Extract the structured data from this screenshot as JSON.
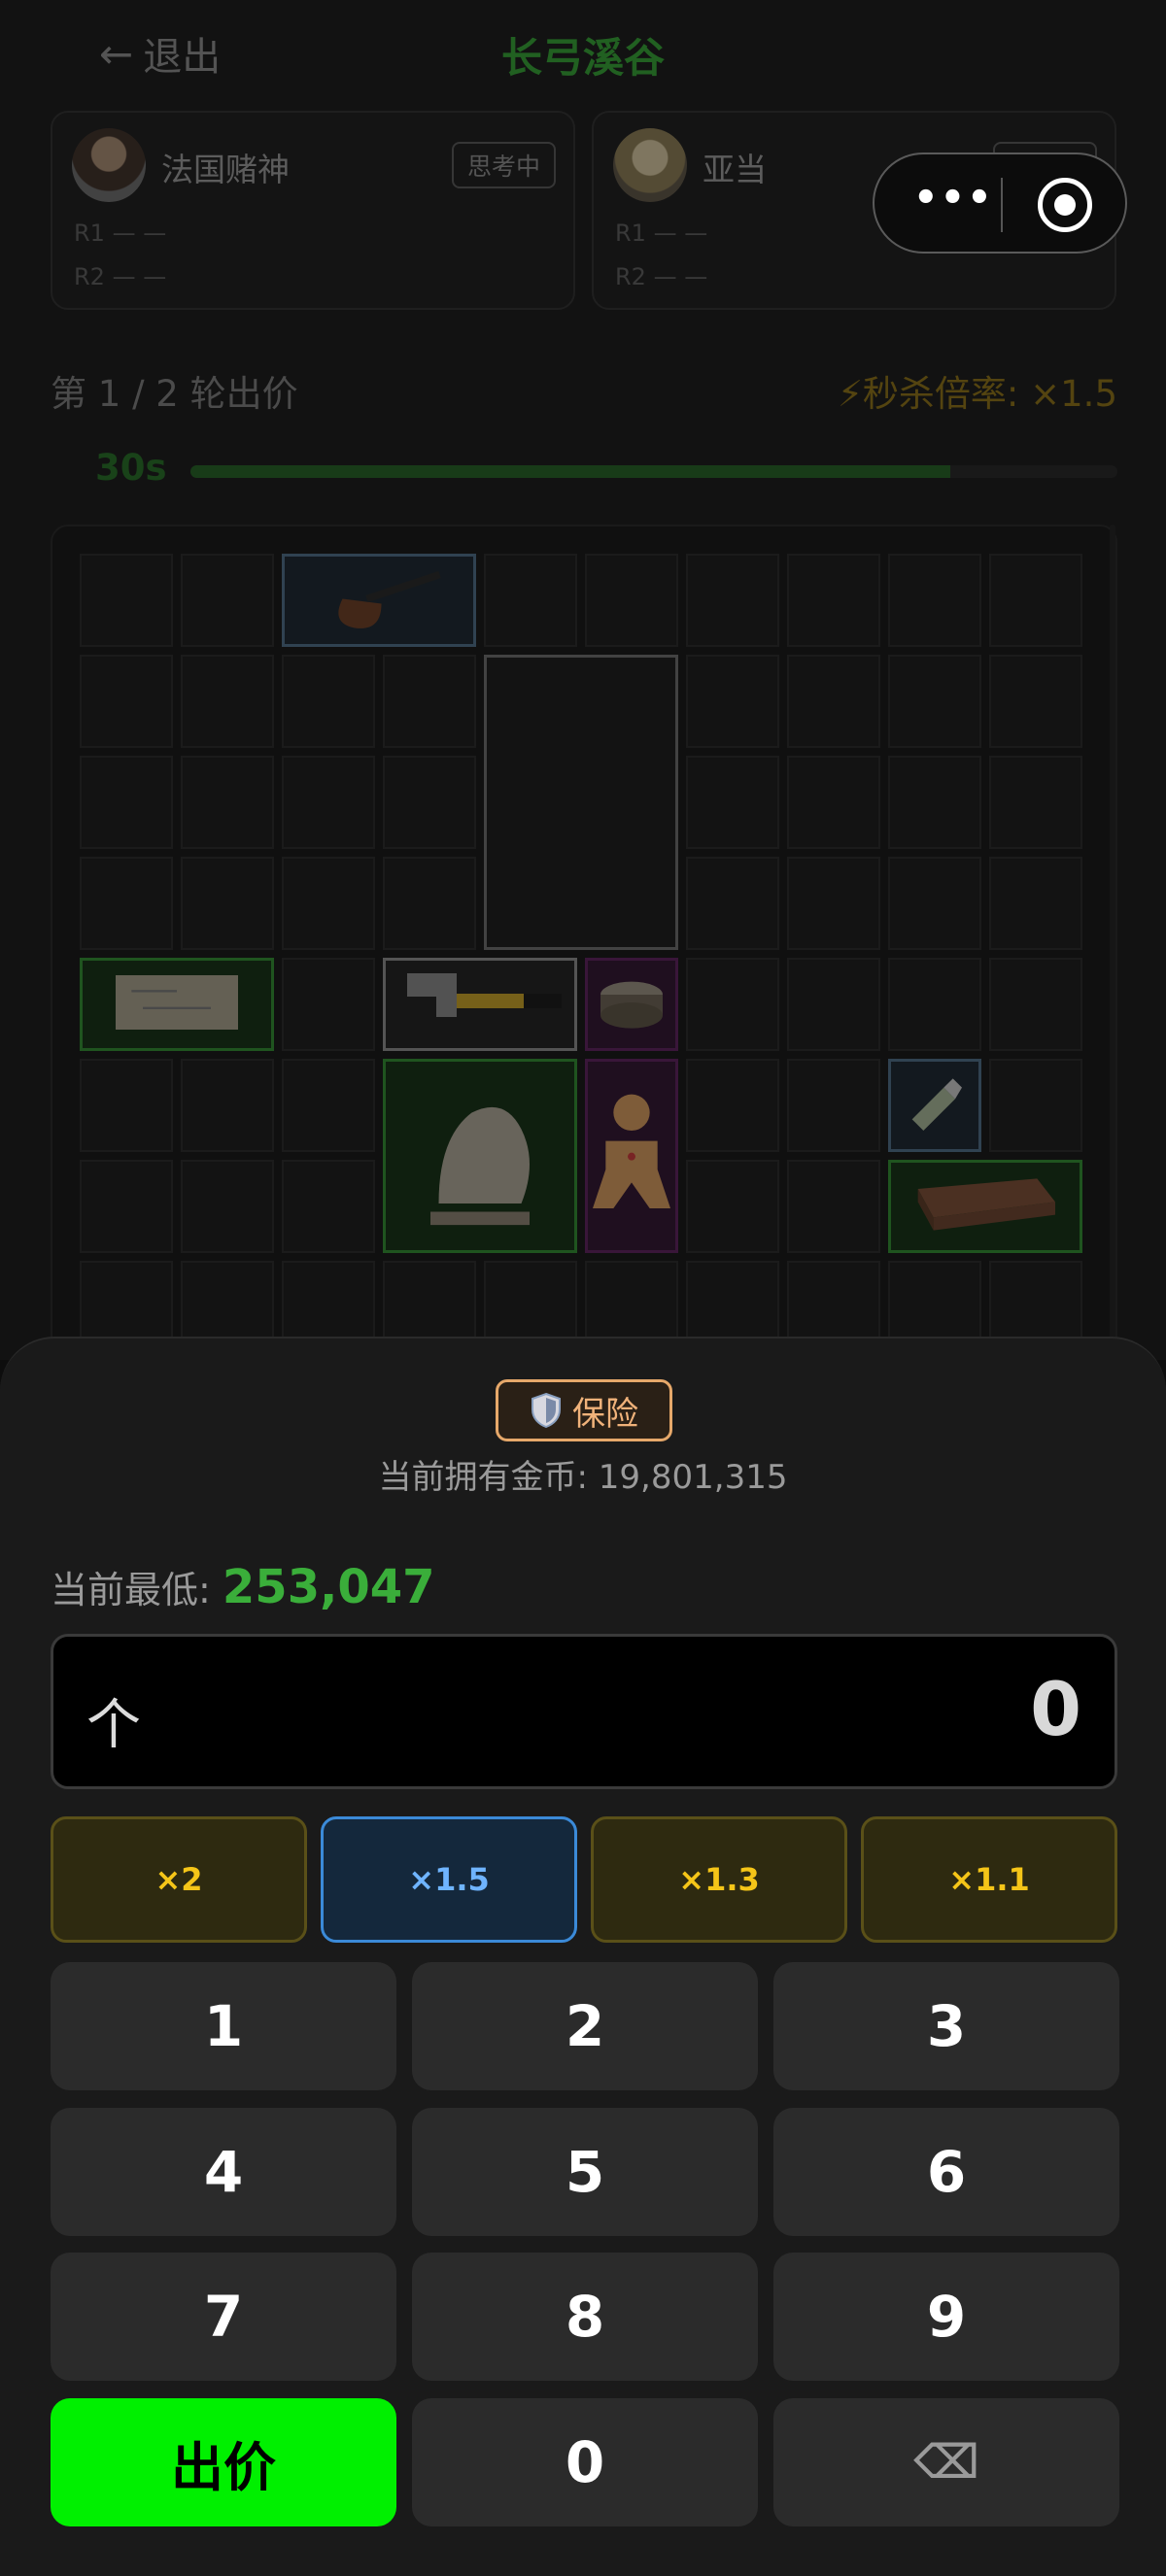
{
  "header": {
    "back_label": "退出",
    "title": "长弓溪谷"
  },
  "players": [
    {
      "name": "法国赌神",
      "status": "思考中",
      "r1": "R1  — —",
      "r2": "R2  — —"
    },
    {
      "name": "亚当",
      "status": "思考中",
      "r1": "R1  — —",
      "r2": "R2  — —"
    }
  ],
  "round": {
    "label": "第 1 / 2 轮出价",
    "kill_rate": "⚡秒杀倍率: ×1.5",
    "timer": "30s",
    "timer_progress": 0.82
  },
  "sheet": {
    "insurance_label": "保险",
    "coins_label": "当前拥有金币: 19,801,315",
    "lowest_label": "当前最低: ",
    "lowest_value": "253,047",
    "bid_value": "0",
    "up_symbol": "个"
  },
  "multipliers": [
    "×2",
    "×1.5",
    "×1.3",
    "×1.1"
  ],
  "keypad": {
    "digits": [
      "1",
      "2",
      "3",
      "4",
      "5",
      "6",
      "7",
      "8",
      "9"
    ],
    "bid_label": "出价",
    "zero": "0",
    "delete_symbol": "⌫"
  },
  "items": [
    {
      "name": "pipe-icon"
    },
    {
      "name": "old-map-icon"
    },
    {
      "name": "hammer-icon"
    },
    {
      "name": "canned-food-icon"
    },
    {
      "name": "statue-icon"
    },
    {
      "name": "gingerbread-icon"
    },
    {
      "name": "usb-drive-icon"
    },
    {
      "name": "wood-plank-icon"
    }
  ],
  "colors": {
    "accent_green": "#00f000",
    "selected_multiplier": "#3b8ad8",
    "multiplier_gold": "#f5c518",
    "insurance_orange": "#e6a86a"
  }
}
